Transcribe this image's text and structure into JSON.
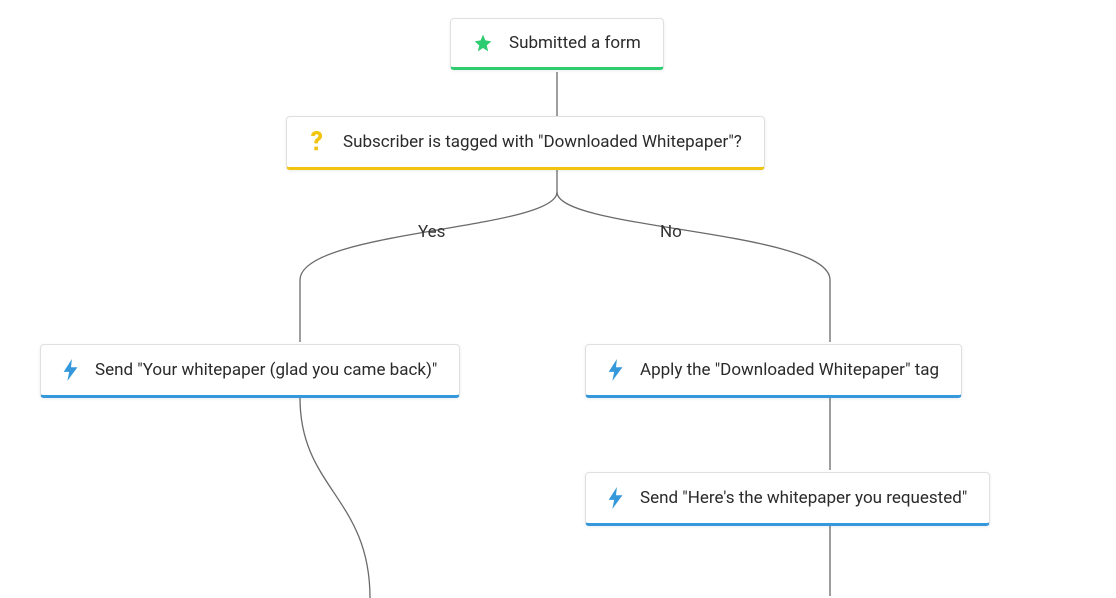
{
  "colors": {
    "green": "#2ecc71",
    "yellow": "#f1c40f",
    "blue": "#3498db"
  },
  "branch_labels": {
    "yes": "Yes",
    "no": "No"
  },
  "nodes": {
    "trigger": {
      "label": "Submitted a form",
      "icon": "star-icon"
    },
    "condition": {
      "label": "Subscriber is tagged with \"Downloaded Whitepaper\"?",
      "icon": "question-icon"
    },
    "yes_action": {
      "label": "Send \"Your whitepaper (glad you came back)\"",
      "icon": "lightning-icon"
    },
    "no_action_1": {
      "label": "Apply the \"Downloaded Whitepaper\" tag",
      "icon": "lightning-icon"
    },
    "no_action_2": {
      "label": "Send \"Here's the whitepaper you requested\"",
      "icon": "lightning-icon"
    }
  }
}
